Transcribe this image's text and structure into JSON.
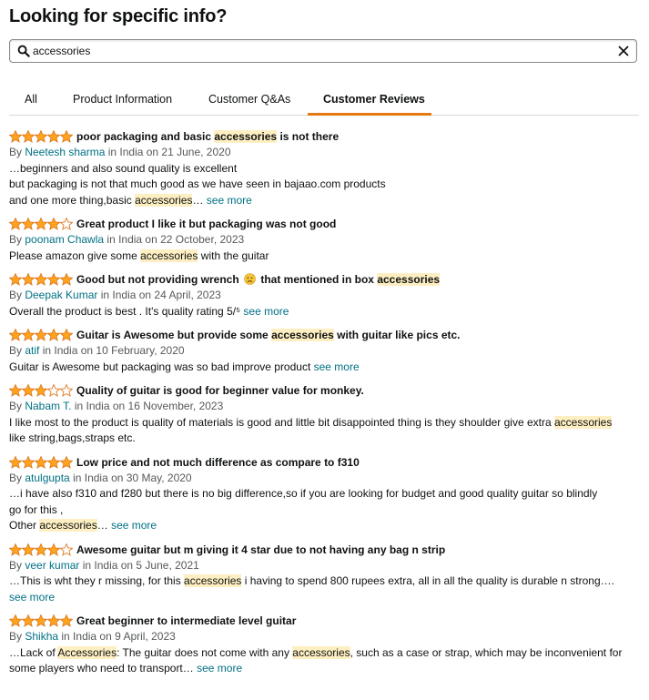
{
  "header": {
    "title": "Looking for specific info?"
  },
  "search": {
    "value": "accessories",
    "placeholder": ""
  },
  "tabs": [
    {
      "label": "All",
      "active": false
    },
    {
      "label": "Product Information",
      "active": false
    },
    {
      "label": "Customer Q&As",
      "active": false
    },
    {
      "label": "Customer Reviews",
      "active": true
    }
  ],
  "colors": {
    "accent": "#e47911",
    "star": "#ffa41c",
    "link": "#007185",
    "highlight": "#feefc3"
  },
  "reviews": [
    {
      "rating": 5,
      "headline": [
        {
          "t": "poor packaging and basic "
        },
        {
          "t": "accessories",
          "hl": true
        },
        {
          "t": " is not there"
        }
      ],
      "by": "By ",
      "author": "Neetesh sharma",
      "location": " in India on 21 June, 2020",
      "body": [
        [
          {
            "t": "…beginners and also sound quality is excellent"
          }
        ],
        [
          {
            "t": "but packaging is not that much good as we have seen in bajaao.com products"
          }
        ],
        [
          {
            "t": "and one more thing,basic "
          },
          {
            "t": "accessories",
            "hl": true
          },
          {
            "t": "… "
          },
          {
            "t": "see more",
            "link": true
          }
        ]
      ]
    },
    {
      "rating": 4,
      "headline": [
        {
          "t": "Great product I like it but packaging was not good"
        }
      ],
      "by": "By ",
      "author": "poonam Chawla",
      "location": " in India on 22 October, 2023",
      "body": [
        [
          {
            "t": "Please amazon give some "
          },
          {
            "t": "accessories",
            "hl": true
          },
          {
            "t": " with the guitar"
          }
        ]
      ]
    },
    {
      "rating": 5,
      "headline": [
        {
          "t": "Good but not providing wrench "
        },
        {
          "emoji": "disappointed-face"
        },
        {
          "t": " that mentioned in box "
        },
        {
          "t": "accessories",
          "hl": true
        }
      ],
      "by": "By ",
      "author": "Deepak Kumar",
      "location": " in India on 24 April, 2023",
      "body": [
        [
          {
            "t": "Overall the product is best . It's quality rating 5/⁵ "
          },
          {
            "t": "see more",
            "link": true
          }
        ]
      ]
    },
    {
      "rating": 5,
      "headline": [
        {
          "t": "Guitar is Awesome but provide some "
        },
        {
          "t": "accessories",
          "hl": true
        },
        {
          "t": " with guitar like pics etc."
        }
      ],
      "by": "By ",
      "author": "atif",
      "location": " in India on 10 February, 2020",
      "body": [
        [
          {
            "t": "Guitar is Awesome but packaging was so bad improve product "
          },
          {
            "t": "see more",
            "link": true
          }
        ]
      ]
    },
    {
      "rating": 3,
      "headline": [
        {
          "t": "Quality of guitar is good for beginner value for monkey."
        }
      ],
      "by": "By ",
      "author": "Nabam T.",
      "location": " in India on 16 November, 2023",
      "body": [
        [
          {
            "t": "I like most to the product is quality of materials is good and little bit disappointed thing is they shoulder give extra "
          },
          {
            "t": "accessories",
            "hl": true
          }
        ],
        [
          {
            "t": "like string,bags,straps etc."
          }
        ]
      ]
    },
    {
      "rating": 5,
      "headline": [
        {
          "t": "Low price and not much difference as compare to f310"
        }
      ],
      "by": "By ",
      "author": "atulgupta",
      "location": " in India on 30 May, 2020",
      "body": [
        [
          {
            "t": "…i have also f310 and f280 but there is no big difference,so if you are looking for budget and good quality guitar so blindly"
          }
        ],
        [
          {
            "t": "go for this ,"
          }
        ],
        [
          {
            "t": "Other "
          },
          {
            "t": "accessories",
            "hl": true
          },
          {
            "t": "… "
          },
          {
            "t": "see more",
            "link": true
          }
        ]
      ]
    },
    {
      "rating": 4,
      "headline": [
        {
          "t": "Awesome guitar but m giving it 4 star due to not having any bag n strip"
        }
      ],
      "by": "By ",
      "author": "veer kumar",
      "location": " in India on 5 June, 2021",
      "body": [
        [
          {
            "t": "…This is wht they r missing, for this "
          },
          {
            "t": "accessories",
            "hl": true
          },
          {
            "t": " i having to spend 800 rupees extra, all in all the quality is durable n strong…."
          }
        ],
        [
          {
            "t": "see more",
            "link": true
          }
        ]
      ]
    },
    {
      "rating": 5,
      "headline": [
        {
          "t": "Great beginner to intermediate level guitar"
        }
      ],
      "by": "By ",
      "author": "Shikha",
      "location": " in India on 9 April, 2023",
      "body": [
        [
          {
            "t": "…Lack of "
          },
          {
            "t": "Accessories",
            "hl": true
          },
          {
            "t": ": The guitar does not come with any "
          },
          {
            "t": "accessories",
            "hl": true
          },
          {
            "t": ", such as a case or strap, which may be inconvenient for"
          }
        ],
        [
          {
            "t": "some players who need to transport… "
          },
          {
            "t": "see more",
            "link": true
          }
        ]
      ]
    }
  ]
}
